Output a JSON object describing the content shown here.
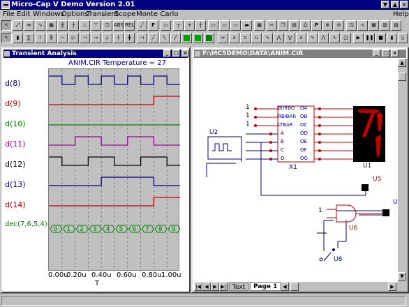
{
  "app": {
    "title": "Micro-Cap V Demo Version 2.01"
  },
  "menu": {
    "items": [
      "File",
      "Edit",
      "Windows",
      "Options",
      "Transient",
      "Scope",
      "Monte Carlo"
    ],
    "help": "Help"
  },
  "toolbar": {
    "abs_label": "ABS",
    "rel_label": "REL",
    "f_label": "F",
    "p_label": "P"
  },
  "transient": {
    "title": "Transient Analysis",
    "plot_title": "ANIM.CIR Temperature = 27",
    "labels": [
      {
        "text": "d(8)",
        "color": "#000080"
      },
      {
        "text": "d(9)",
        "color": "#c00000"
      },
      {
        "text": "d(10)",
        "color": "#008000"
      },
      {
        "text": "d(11)",
        "color": "#a000a0"
      },
      {
        "text": "d(12)",
        "color": "#000000"
      },
      {
        "text": "d(13)",
        "color": "#000080"
      },
      {
        "text": "d(14)",
        "color": "#c00000"
      },
      {
        "text": "dec(7,6,5,4)",
        "color": "#008000"
      }
    ],
    "bus_values": [
      "0",
      "1",
      "2",
      "3",
      "4",
      "5",
      "6",
      "7",
      "8",
      "9"
    ],
    "x_ticks": [
      "0.00u",
      "0.20u",
      "0.40u",
      "0.60u",
      "0.80u",
      "1.00u"
    ],
    "x_label": "T"
  },
  "schematic": {
    "title": "F:\\MC5DEMO\\DATA\\ANIM.CIR",
    "pins_left": [
      "BI/RBO",
      "RBIBAR",
      "LTBAR",
      "A",
      "B",
      "C",
      "D"
    ],
    "pins_right": [
      "OA",
      "OB",
      "OC",
      "OD",
      "OE",
      "OF",
      "OG"
    ],
    "one_labels": [
      "1",
      "1",
      "1",
      "1"
    ],
    "parts": {
      "x1": "X1",
      "u1": "U1",
      "u2": "U2",
      "u5": "U5",
      "u6": "U6",
      "u8": "U8",
      "u_cut": "U"
    },
    "display_digit": "7",
    "tabs": {
      "text": "Text",
      "page": "Page 1"
    }
  },
  "colors": {
    "titlebar": "#000080",
    "wire": "#000080",
    "component": "#c00000",
    "digit": "#c00000"
  }
}
